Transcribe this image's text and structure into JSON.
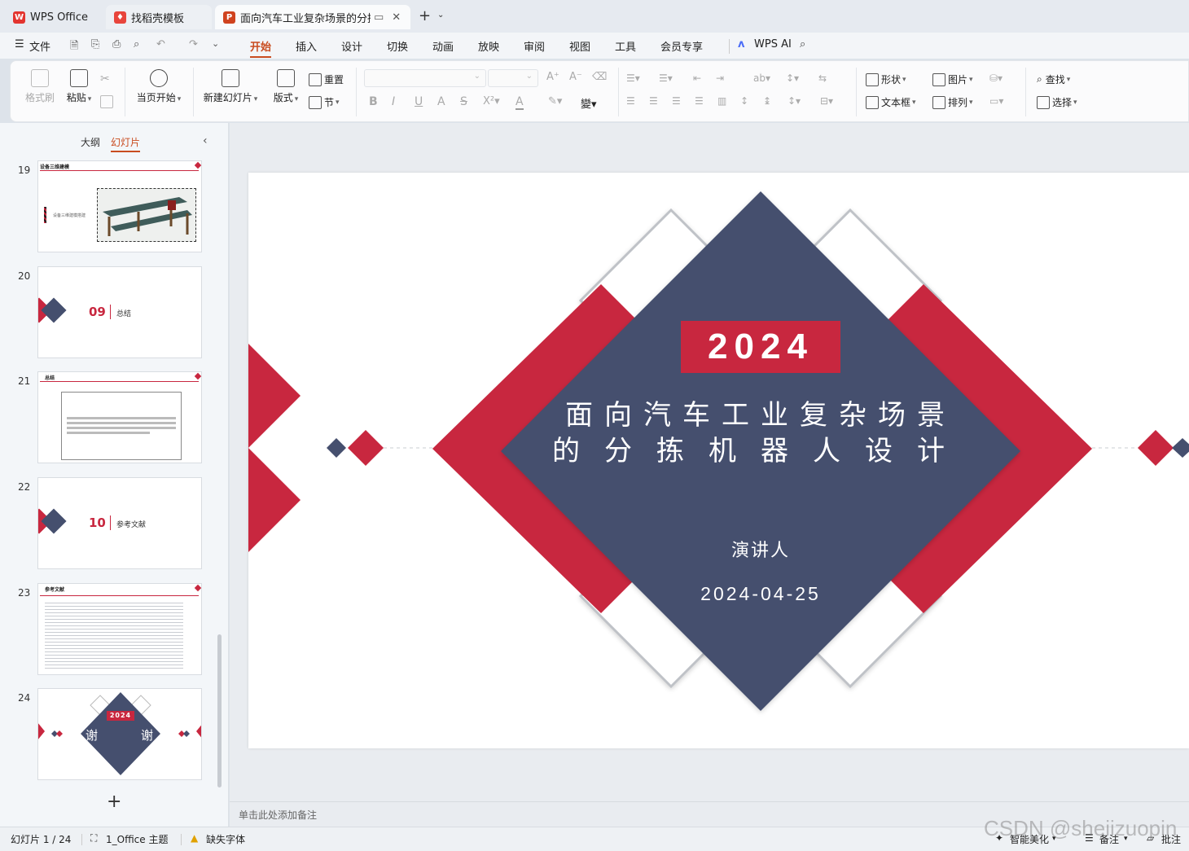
{
  "tabs": [
    {
      "label": "WPS Office",
      "icon": "wps-logo-icon"
    },
    {
      "label": "找稻壳模板",
      "icon": "docer-icon"
    },
    {
      "label": "面向汽车工业复杂场景的分拣",
      "icon": "presentation-icon"
    }
  ],
  "menu": {
    "file": "文件",
    "items": [
      "开始",
      "插入",
      "设计",
      "切换",
      "动画",
      "放映",
      "审阅",
      "视图",
      "工具",
      "会员专享"
    ],
    "active": "开始",
    "ai": "WPS AI"
  },
  "ribbon": {
    "format_painter": "格式刷",
    "paste": "粘贴",
    "from_start": "当页开始",
    "new_slide": "新建幻灯片",
    "layout": "版式",
    "reset": "重置",
    "section": "节",
    "shape": "形状",
    "picture": "图片",
    "find": "查找",
    "textbox": "文本框",
    "arrange": "排列",
    "select": "选择"
  },
  "panel": {
    "outline_tab": "大纲",
    "slides_tab": "幻灯片",
    "add": "+"
  },
  "thumbs": {
    "t19": {
      "num": "19",
      "title": "设备三维建模",
      "caption": "设备三维建模搭建"
    },
    "t20": {
      "num": "20",
      "section_no": "09",
      "section_title": "总结"
    },
    "t21": {
      "num": "21",
      "title": "总结"
    },
    "t22": {
      "num": "22",
      "section_no": "10",
      "section_title": "参考文献"
    },
    "t23": {
      "num": "23",
      "title": "参考文献"
    },
    "t24": {
      "num": "24",
      "year": "2024",
      "thanks_left": "谢",
      "thanks_right": "谢"
    }
  },
  "slide": {
    "year": "2024",
    "title_line1": "面向汽车工业复杂场景",
    "title_line2": "的分拣机器人设计",
    "presenter": "演讲人",
    "date": "2024-04-25"
  },
  "notes_placeholder": "单击此处添加备注",
  "status": {
    "slide_counter": "幻灯片 1 / 24",
    "theme": "1_Office 主题",
    "missing_font": "缺失字体",
    "smart_beautify": "智能美化",
    "notes": "备注",
    "comments": "批注",
    "watermark": "CSDN @sheiizuopin"
  },
  "colors": {
    "accent_red": "#c8273f",
    "navy": "#454f6e",
    "tab_accent": "#c94c1f"
  }
}
